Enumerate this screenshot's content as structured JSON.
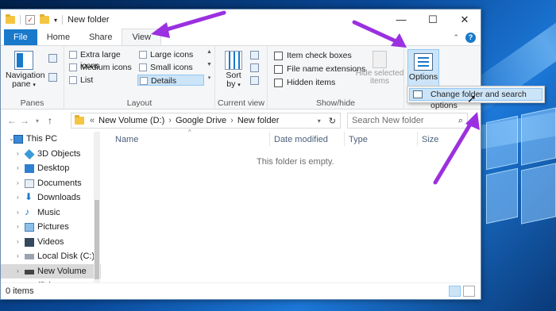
{
  "window": {
    "title": "New folder"
  },
  "tabs": [
    {
      "label": "File"
    },
    {
      "label": "Home"
    },
    {
      "label": "Share"
    },
    {
      "label": "View"
    }
  ],
  "ribbon": {
    "panes": {
      "nav_pane_label": "Navigation pane",
      "group_label": "Panes"
    },
    "layout": {
      "items": [
        "Extra large icons",
        "Large icons",
        "Medium icons",
        "Small icons",
        "List",
        "Details"
      ],
      "selected": "Details",
      "group_label": "Layout"
    },
    "current_view": {
      "sort_label": "Sort by",
      "group_label": "Current view"
    },
    "show_hide": {
      "item_check_boxes": "Item check boxes",
      "file_name_extensions": "File name extensions",
      "hidden_items": "Hidden items",
      "hide_selected": "Hide selected items",
      "group_label": "Show/hide"
    },
    "options": {
      "label": "Options"
    }
  },
  "dropdown": {
    "item": "Change folder and search options"
  },
  "address": {
    "segments": [
      "New Volume (D:)",
      "Google Drive",
      "New folder"
    ]
  },
  "search": {
    "placeholder": "Search New folder"
  },
  "nav": [
    {
      "label": "This PC",
      "icon": "pc-icon"
    },
    {
      "label": "3D Objects",
      "icon": "cube-icon"
    },
    {
      "label": "Desktop",
      "icon": "desktop-icon"
    },
    {
      "label": "Documents",
      "icon": "documents-icon"
    },
    {
      "label": "Downloads",
      "icon": "download-icon"
    },
    {
      "label": "Music",
      "icon": "music-icon"
    },
    {
      "label": "Pictures",
      "icon": "pictures-icon"
    },
    {
      "label": "Videos",
      "icon": "videos-icon"
    },
    {
      "label": "Local Disk (C:)",
      "icon": "drive-icon"
    },
    {
      "label": "New Volume (D:)",
      "icon": "drive-icon"
    }
  ],
  "columns": [
    "Name",
    "Date modified",
    "Type",
    "Size"
  ],
  "empty_message": "This folder is empty.",
  "status": {
    "item_count": "0 items"
  },
  "colors": {
    "accent": "#1979ca",
    "annotation": "#9b30e0",
    "selection": "#cce4f7"
  }
}
